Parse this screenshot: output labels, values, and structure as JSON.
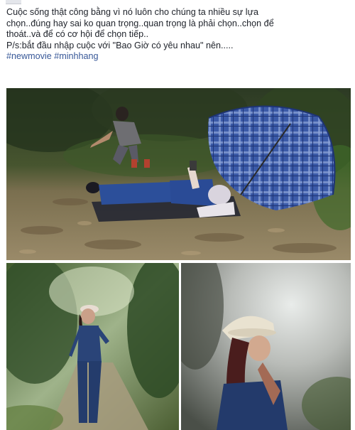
{
  "post": {
    "line1": "Cuộc sống thật công bằng vì nó luôn cho chúng ta nhiều sự lựa",
    "line2": "chọn..đúng hay sai ko quan trọng..quan trọng là phải chọn..chọn để",
    "line3": "thoát..và để có cơ hội để chọn tiếp..",
    "line4": "P/s:bắt đầu nhập cuộc với \"Bao Giờ có yêu nhau\" nên.....",
    "hashtags": [
      "#newmovie",
      "#minhhang"
    ]
  },
  "colors": {
    "text": "#1d2129",
    "link": "#385898",
    "umbrella": "#3b5aa8"
  },
  "icons": {
    "thumbnail": "profile-thumbnail"
  }
}
